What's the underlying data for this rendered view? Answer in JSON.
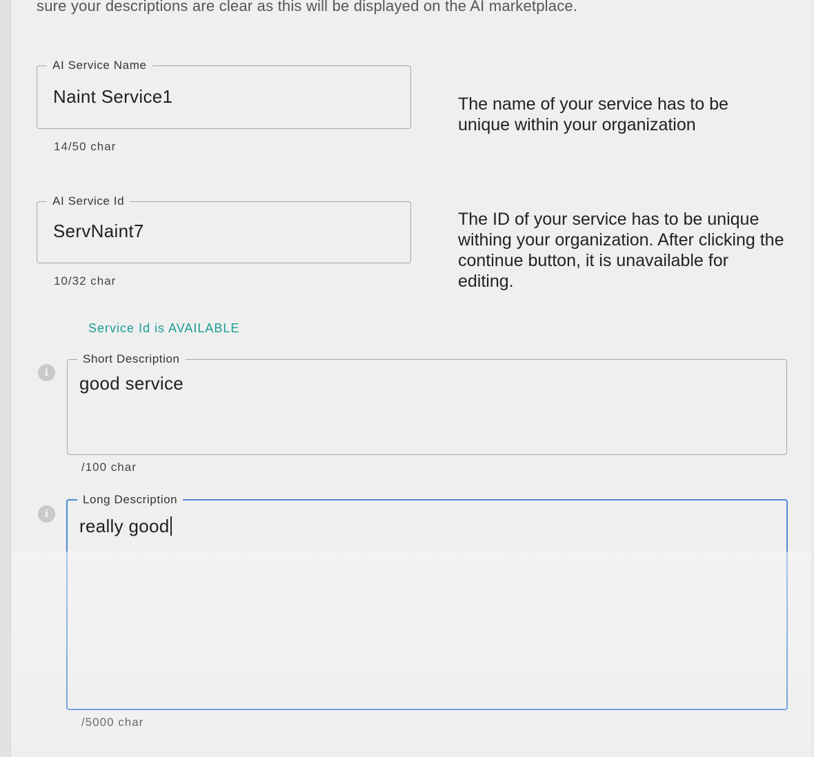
{
  "intro_text": "sure your descriptions are clear as this will be displayed on the AI marketplace.",
  "fields": {
    "service_name": {
      "label": "AI Service Name",
      "value": "Naint Service1",
      "counter": "14/50 char",
      "help": "The name of your service has to be unique within your organization"
    },
    "service_id": {
      "label": "AI Service Id",
      "value": "ServNaint7",
      "counter": "10/32 char",
      "help": "The ID of your service has to be unique withing your organization. After clicking the continue button, it is unavailable for editing.",
      "availability": "Service Id is AVAILABLE"
    },
    "short_description": {
      "label": "Short Description",
      "value": "good service",
      "counter": "/100 char"
    },
    "long_description": {
      "label": "Long Description",
      "value": "really good",
      "counter": "/5000 char"
    }
  },
  "icons": {
    "info": "info-icon"
  },
  "colors": {
    "focus_border": "#4a8ad8",
    "available_text": "#1a9e94"
  }
}
